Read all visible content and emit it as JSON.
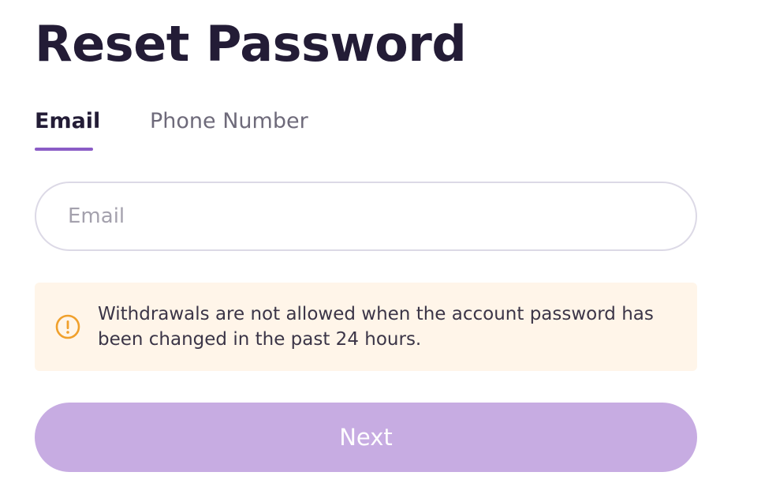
{
  "page": {
    "title": "Reset Password"
  },
  "tabs": {
    "items": [
      {
        "label": "Email",
        "active": true
      },
      {
        "label": "Phone Number",
        "active": false
      }
    ]
  },
  "form": {
    "email_value": "",
    "email_placeholder": "Email"
  },
  "notice": {
    "icon": "warning-circle-icon",
    "text": "Withdrawals are not allowed when the account password has been changed in the past 24 hours."
  },
  "actions": {
    "next_label": "Next"
  },
  "colors": {
    "title_text": "#231c36",
    "tab_active_underline": "#8b5cc6",
    "notice_background": "#fff5e9",
    "notice_icon": "#f0a02c",
    "button_background": "#c7ace2"
  }
}
